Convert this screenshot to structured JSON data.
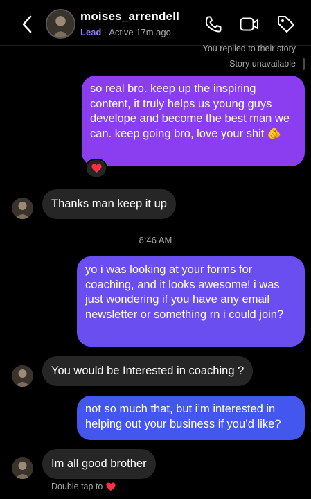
{
  "header": {
    "username": "moises_arrendell",
    "label": "Lead",
    "separator": "·",
    "status": "Active 17m ago",
    "icons": [
      "back-chevron-icon",
      "phone-icon",
      "video-icon",
      "tag-icon"
    ]
  },
  "story": {
    "replied": "You replied to their story",
    "unavailable": "Story unavailable"
  },
  "messages": [
    {
      "from": "me",
      "text": "so real bro. keep up the inspiring content, it truly helps us young guys develope and become the best man we can. keep going bro, love your shit",
      "emoji": "🫵",
      "reaction": "❤️"
    },
    {
      "from": "them",
      "text": "Thanks man keep it up"
    },
    {
      "from": "me",
      "text": "yo i was looking at your forms for coaching, and it looks awesome! i was just wondering if you have any email newsletter or something rn i could join?"
    },
    {
      "from": "them",
      "text": "You would be Interested in coaching ?"
    },
    {
      "from": "me",
      "text": "not so much that, but i’m interested in helping out your business if you’d like?"
    },
    {
      "from": "them",
      "text": "Im all good brother"
    }
  ],
  "timestamp": "8:46 AM",
  "double_tap": {
    "text": "Double tap to",
    "emoji": "❤️"
  },
  "colors": {
    "bubble_purple": "#8a3ef0",
    "bubble_violet": "#6a4ef0",
    "bubble_blue": "#4356ee",
    "incoming_bubble": "#262626",
    "lead_label": "#8e7cf4"
  }
}
